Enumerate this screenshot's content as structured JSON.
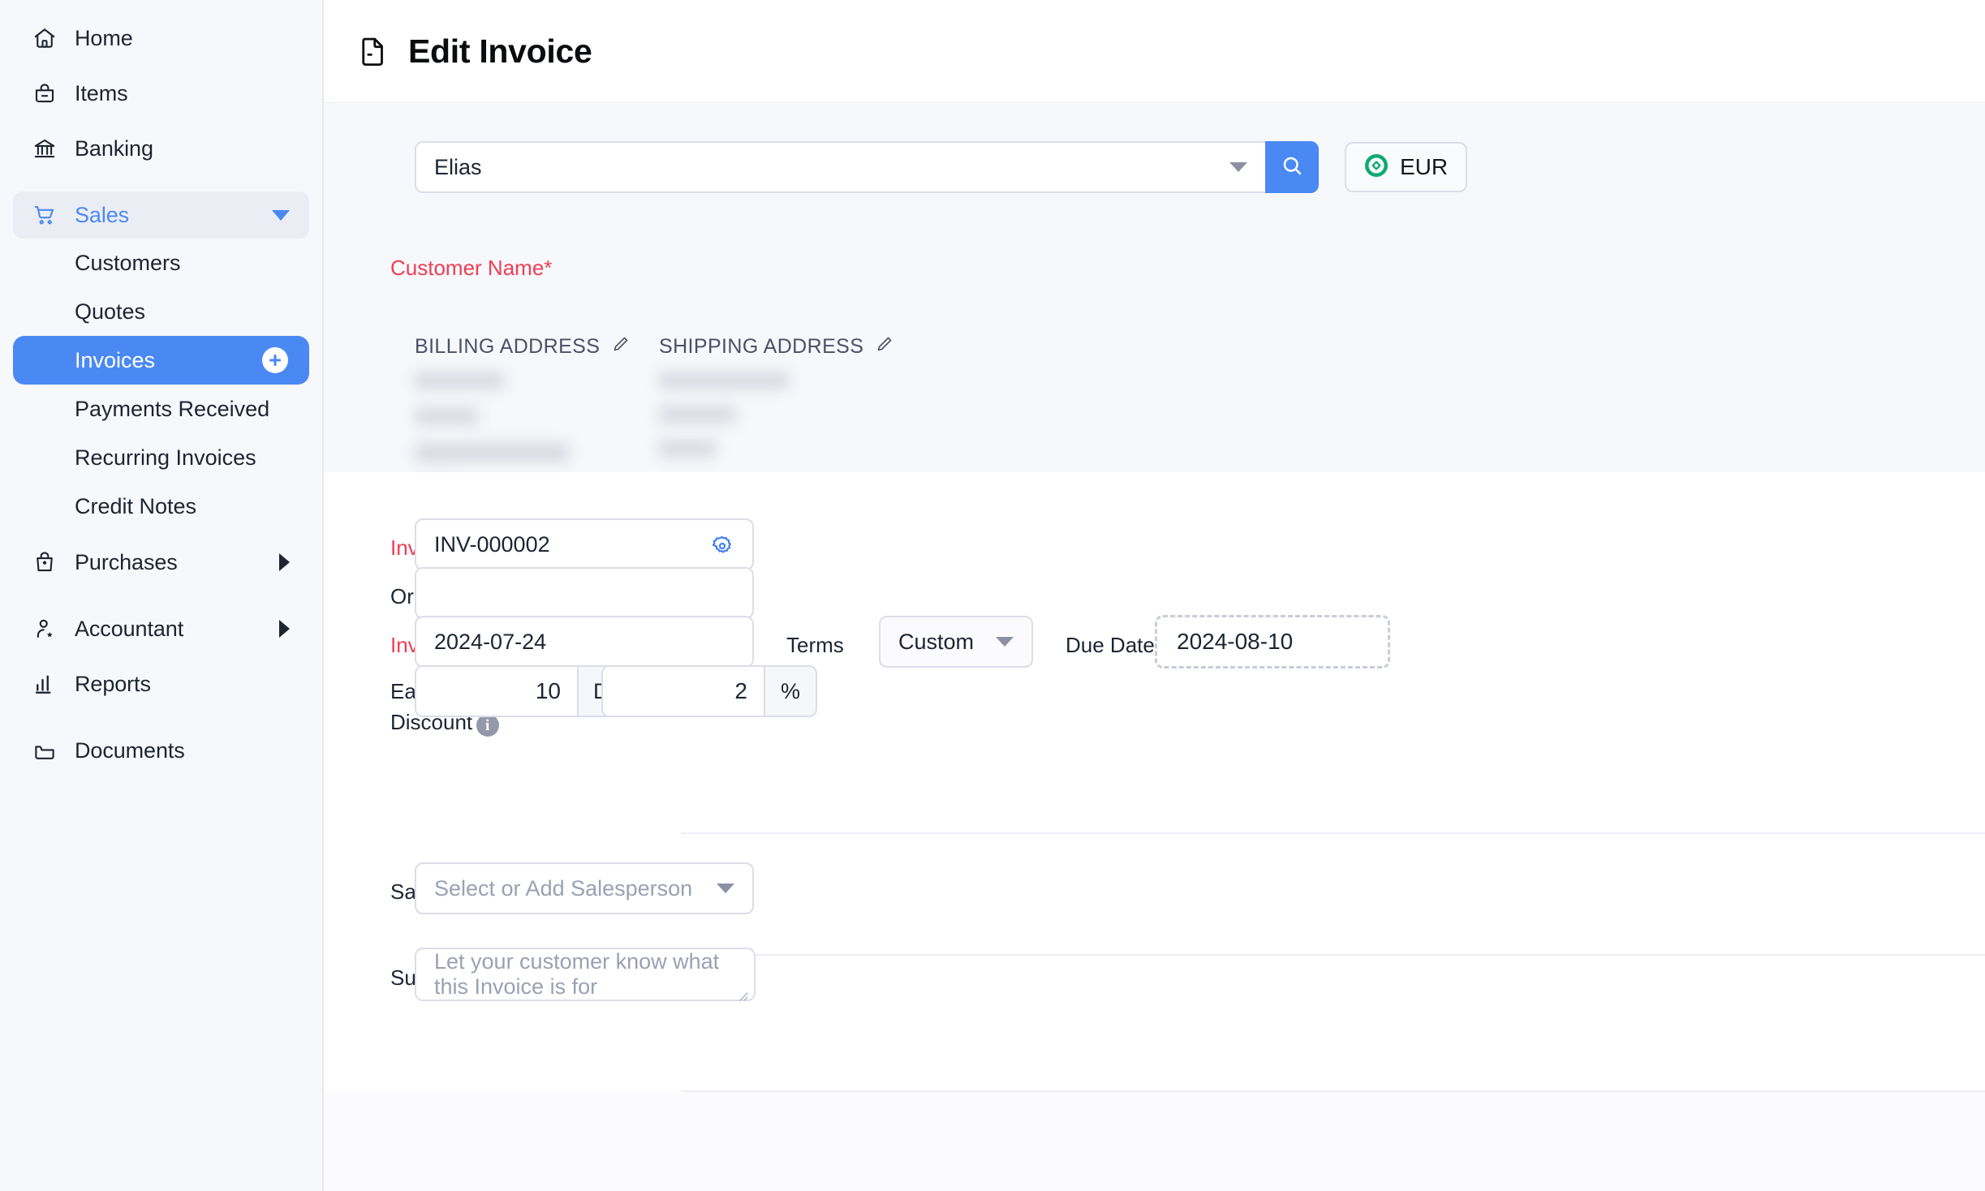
{
  "sidebar": {
    "items": [
      {
        "label": "Home",
        "icon": "home-icon",
        "type": "nav"
      },
      {
        "label": "Items",
        "icon": "items-icon",
        "type": "nav"
      },
      {
        "label": "Banking",
        "icon": "bank-icon",
        "type": "nav"
      },
      {
        "label": "Sales",
        "icon": "cart-icon",
        "type": "group",
        "expanded": true,
        "caret": "chevron-down-icon"
      },
      {
        "label": "Customers",
        "type": "sub"
      },
      {
        "label": "Quotes",
        "type": "sub"
      },
      {
        "label": "Invoices",
        "type": "sub",
        "selected": true,
        "badge": "plus-icon"
      },
      {
        "label": "Payments Received",
        "type": "sub"
      },
      {
        "label": "Recurring Invoices",
        "type": "sub"
      },
      {
        "label": "Credit Notes",
        "type": "sub"
      },
      {
        "label": "Purchases",
        "icon": "purchases-icon",
        "type": "group",
        "caret": "chevron-right-icon"
      },
      {
        "label": "Accountant",
        "icon": "accountant-icon",
        "type": "group",
        "caret": "chevron-right-icon"
      },
      {
        "label": "Reports",
        "icon": "reports-icon",
        "type": "nav"
      },
      {
        "label": "Documents",
        "icon": "documents-icon",
        "type": "nav"
      }
    ]
  },
  "header": {
    "title": "Edit Invoice",
    "icon": "document-icon"
  },
  "form": {
    "customer": {
      "label": "Customer Name*",
      "value": "Elias",
      "search_icon": "search-icon",
      "dropdown_icon": "chevron-down-icon"
    },
    "currency": {
      "code": "EUR",
      "icon": "currency-icon",
      "color": "#0eab6e"
    },
    "billing_address": {
      "label": "BILLING ADDRESS",
      "edit_icon": "pencil-icon",
      "redacted": true
    },
    "shipping_address": {
      "label": "SHIPPING ADDRESS",
      "edit_icon": "pencil-icon",
      "redacted": true
    },
    "invoice_number": {
      "label": "Invoice#*",
      "value": "INV-000002",
      "settings_icon": "gear-icon"
    },
    "order_number": {
      "label": "Order Number",
      "value": ""
    },
    "invoice_date": {
      "label": "Invoice Date*",
      "value": "2024-07-24"
    },
    "terms": {
      "label": "Terms",
      "value": "Custom",
      "dropdown_icon": "chevron-down-icon"
    },
    "due_date": {
      "label": "Due Date",
      "value": "2024-08-10"
    },
    "early_payment_discount": {
      "label_line1": "Early Payment",
      "label_line2": "Discount",
      "info_icon": "info-icon",
      "days_value": "10",
      "days_suffix": "Days",
      "percent_value": "2",
      "percent_suffix": "%",
      "highlighted": true,
      "highlight_color": "#f50a54"
    },
    "salesperson": {
      "label": "Salesperson",
      "placeholder": "Select or Add Salesperson",
      "dropdown_icon": "chevron-down-icon"
    },
    "subject": {
      "label": "Subject",
      "info_icon": "info-icon",
      "placeholder": "Let your customer know what this Invoice is for"
    }
  },
  "colors": {
    "accent": "#4a89f3",
    "required": "#ee3d54",
    "highlight": "#f50a54",
    "sidebar_bg": "#f7f8fc",
    "panel_bg": "#f7f8fb"
  }
}
